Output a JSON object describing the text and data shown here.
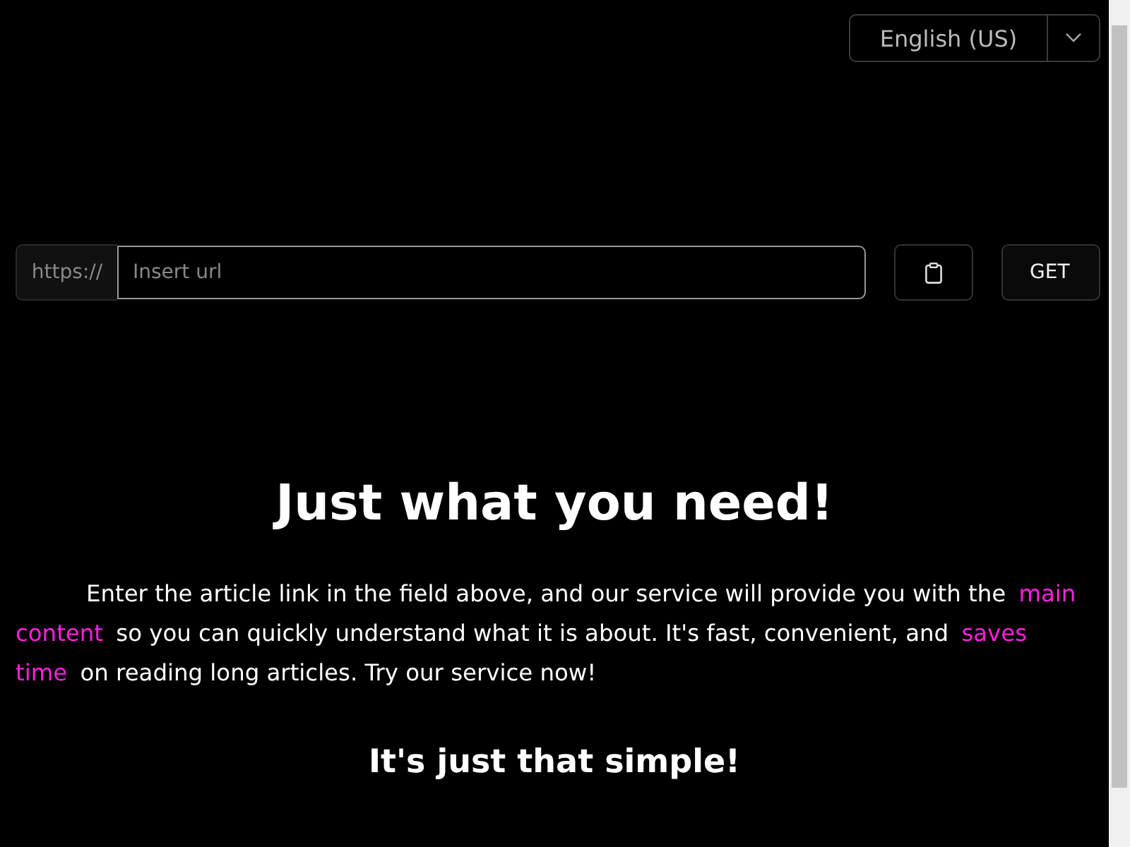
{
  "language_select": {
    "value": "English (US)"
  },
  "url_form": {
    "prefix": "https://",
    "placeholder": "Insert url",
    "submit": "GET"
  },
  "heading": "Just what you need!",
  "intro": [
    {
      "text": "Enter the article link in the field above, and our service will provide you with the ",
      "highlight": false
    },
    {
      "text": "main content",
      "highlight": true
    },
    {
      "text": " so you can quickly understand what it is about. It's fast, convenient, and ",
      "highlight": false
    },
    {
      "text": "saves time",
      "highlight": true
    },
    {
      "text": " on reading long articles. Try our service now!",
      "highlight": false
    }
  ],
  "subheading": "It's just that simple!"
}
